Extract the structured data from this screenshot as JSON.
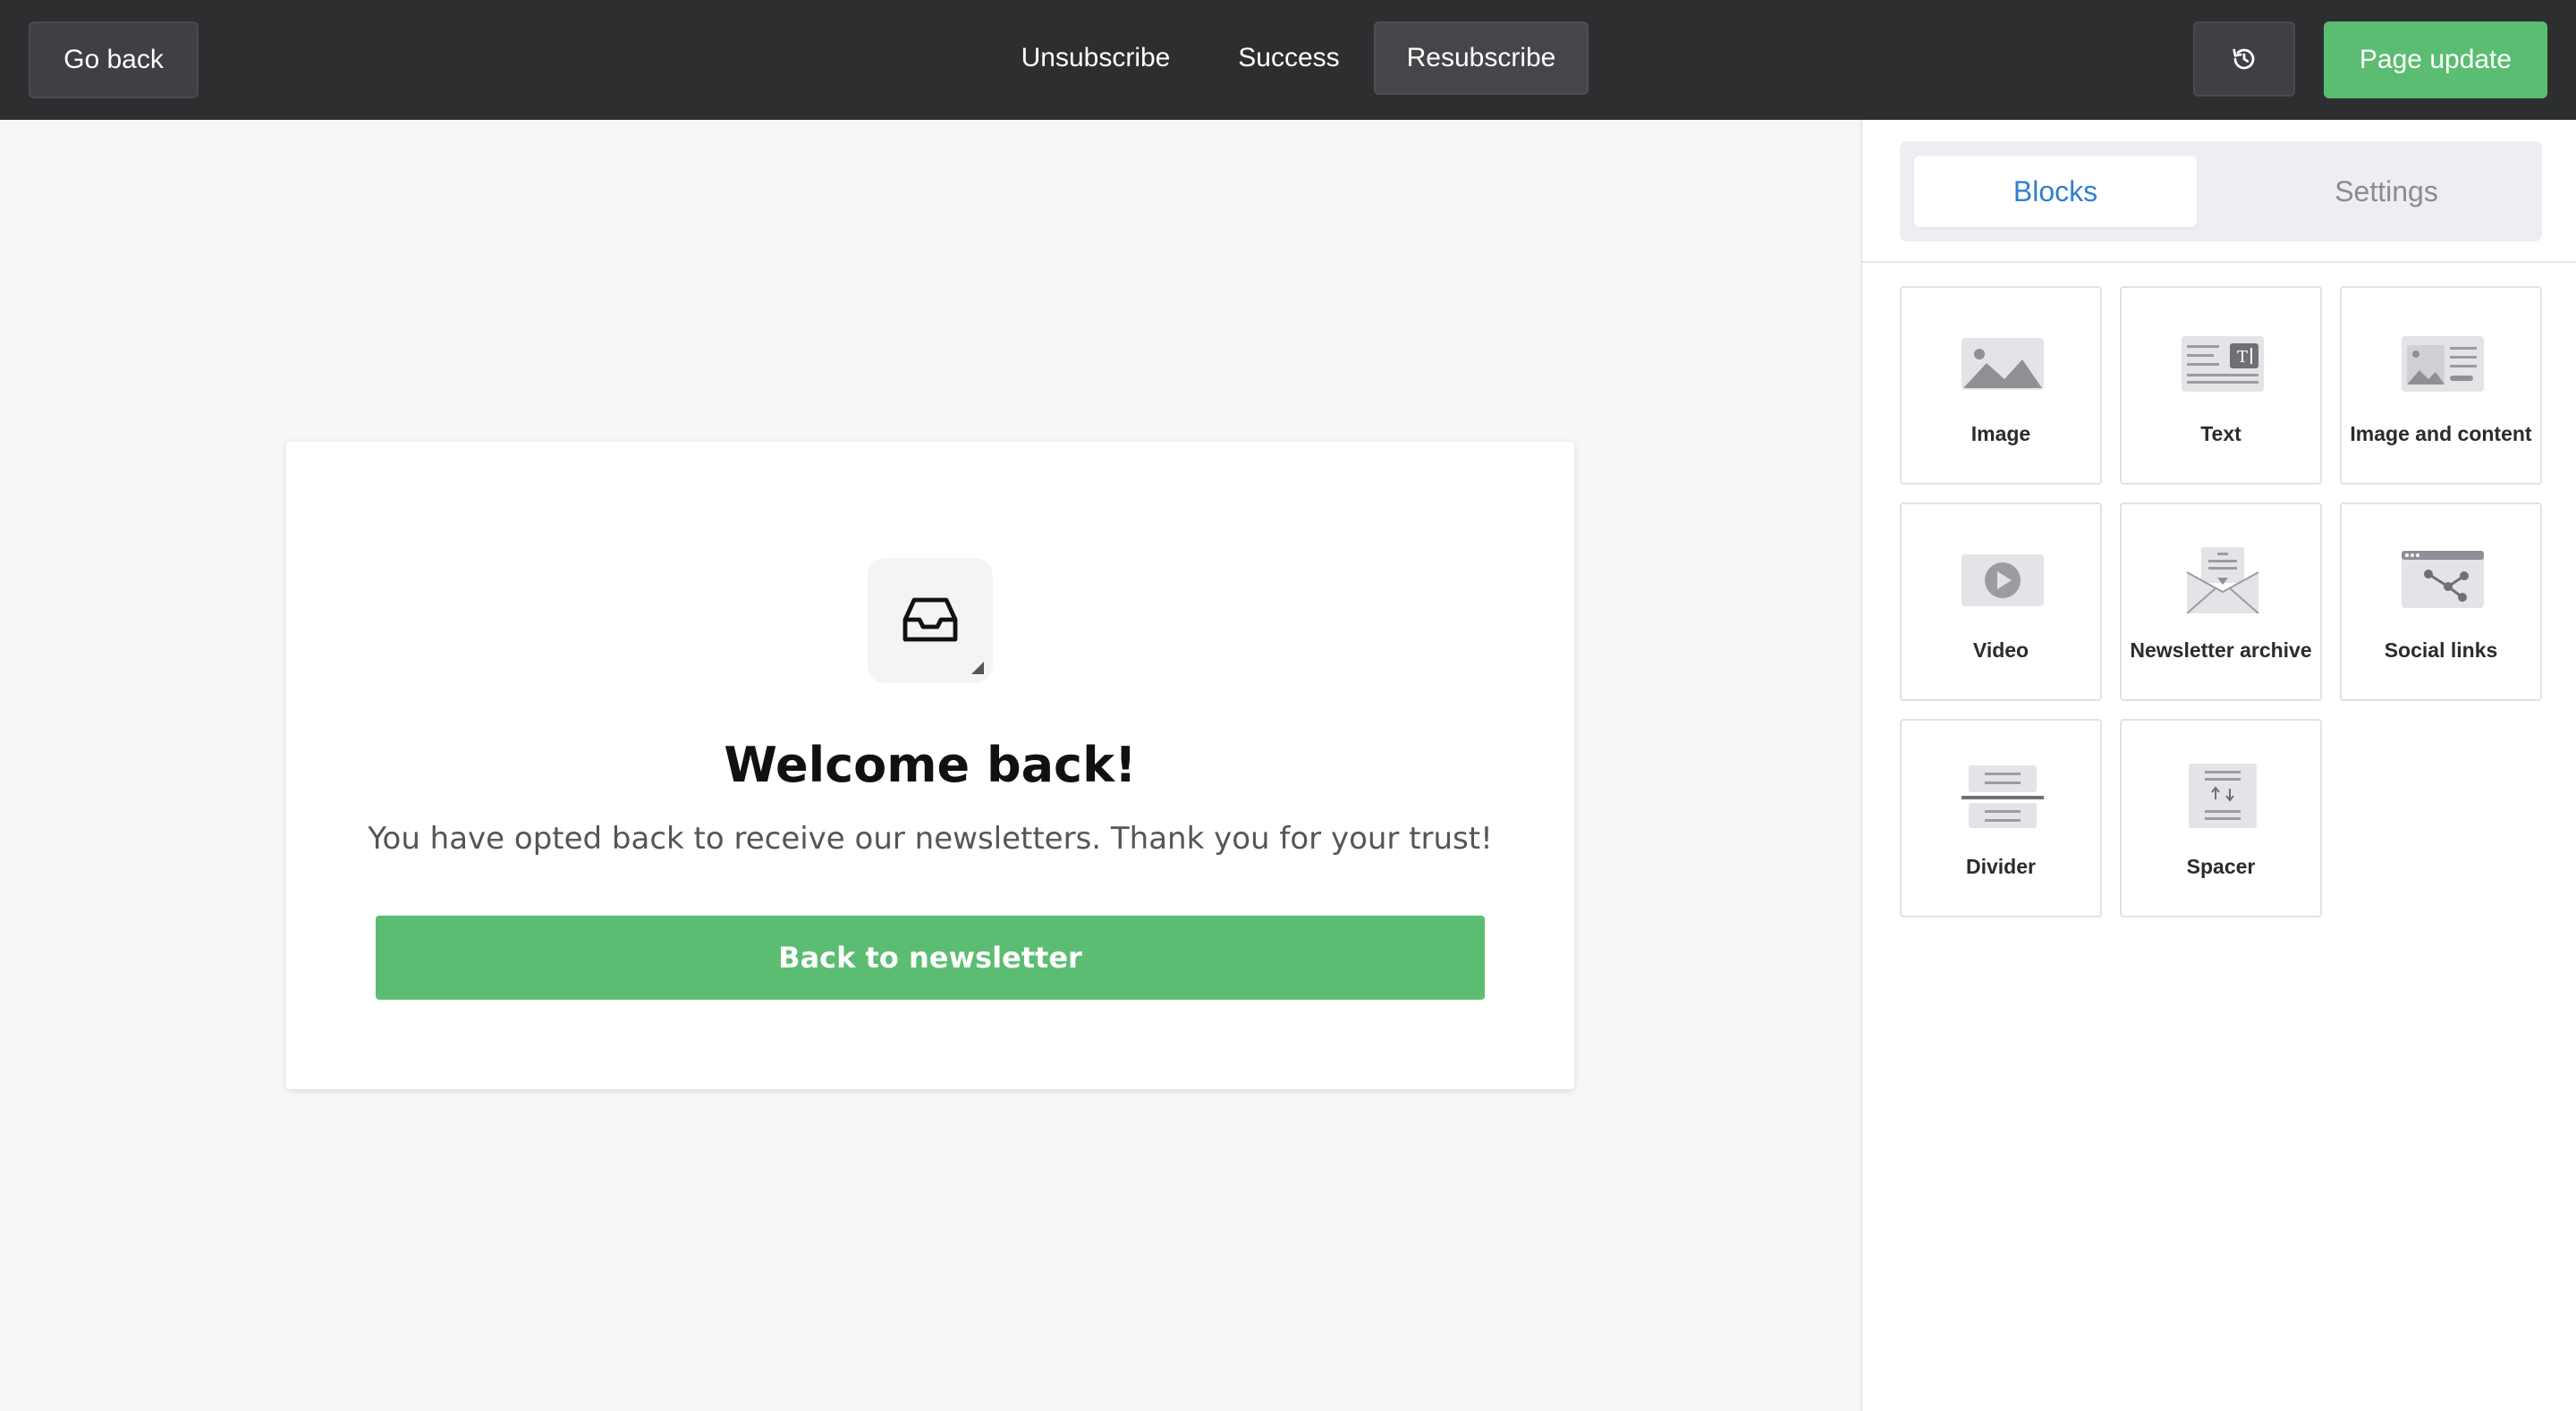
{
  "topbar": {
    "go_back_label": "Go back",
    "tabs": [
      {
        "label": "Unsubscribe"
      },
      {
        "label": "Success"
      },
      {
        "label": "Resubscribe"
      }
    ],
    "history_icon": "history-icon",
    "page_update_label": "Page update"
  },
  "card": {
    "icon": "inbox-icon",
    "title": "Welcome back!",
    "subtitle": "You have opted back to receive our newsletters. Thank you for your trust!",
    "button_label": "Back to newsletter"
  },
  "sidebar": {
    "tabs": [
      {
        "label": "Blocks"
      },
      {
        "label": "Settings"
      }
    ],
    "blocks": [
      {
        "label": "Image",
        "icon": "image-block-icon"
      },
      {
        "label": "Text",
        "icon": "text-block-icon"
      },
      {
        "label": "Image and content",
        "icon": "image-content-block-icon"
      },
      {
        "label": "Video",
        "icon": "video-block-icon"
      },
      {
        "label": "Newsletter archive",
        "icon": "newsletter-archive-icon"
      },
      {
        "label": "Social links",
        "icon": "social-links-icon"
      },
      {
        "label": "Divider",
        "icon": "divider-block-icon"
      },
      {
        "label": "Spacer",
        "icon": "spacer-block-icon"
      }
    ]
  },
  "colors": {
    "topbar": "#2d2e30",
    "accent_green": "#5bbd72",
    "active_tab_blue": "#2f80d1",
    "canvas_bg": "#f6f7f9"
  }
}
